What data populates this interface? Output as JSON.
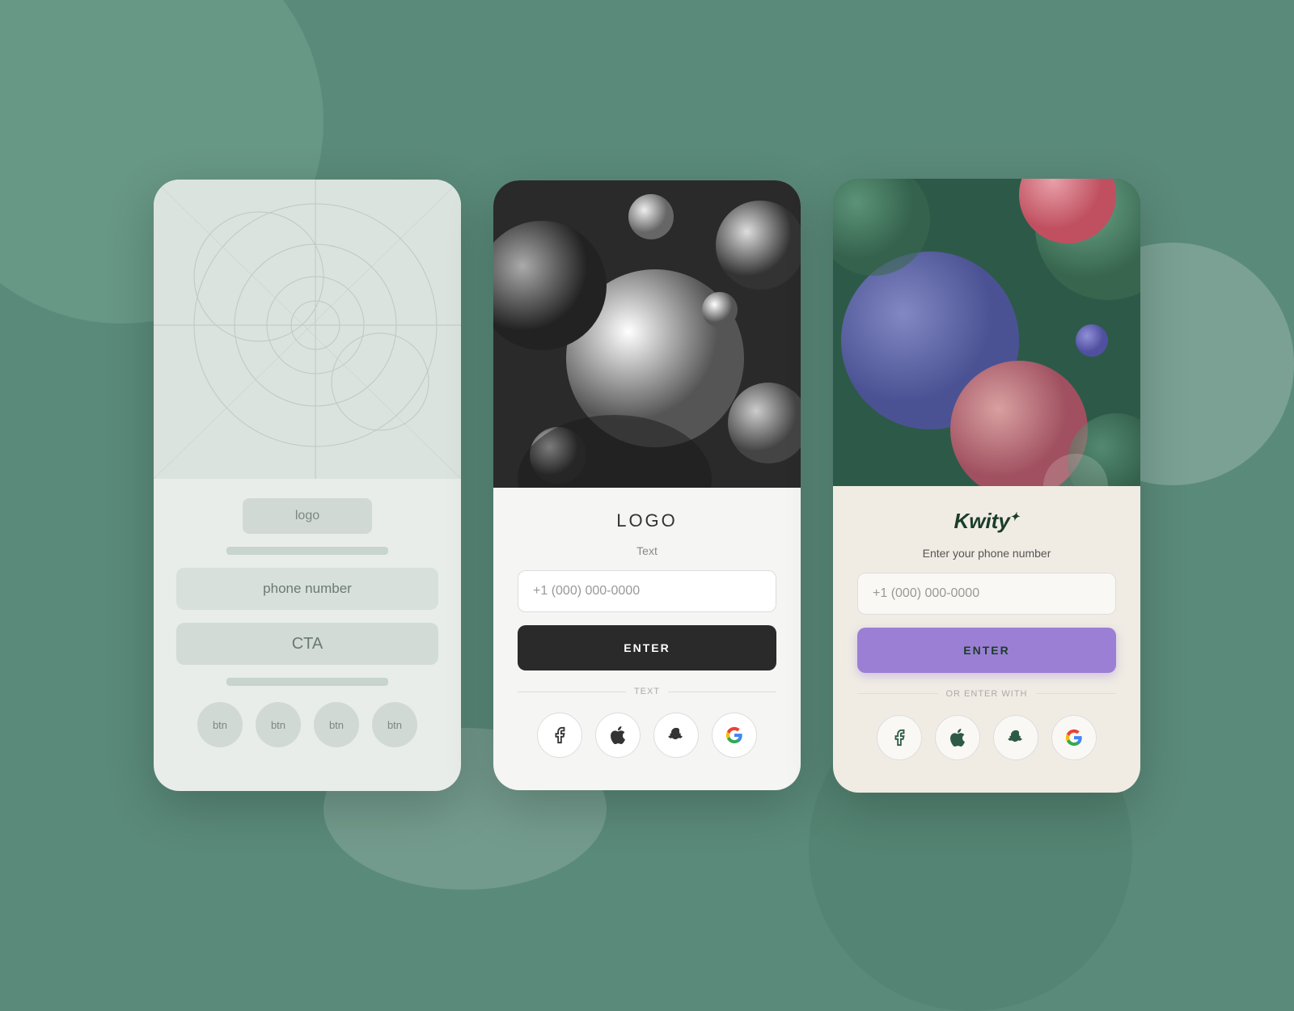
{
  "background": {
    "color": "#5a8a7a"
  },
  "cards": {
    "wireframe": {
      "logo_label": "logo",
      "phone_number_label": "phone number",
      "cta_label": "CTA",
      "btn_labels": [
        "btn",
        "btn",
        "btn",
        "btn"
      ]
    },
    "dark": {
      "logo_label": "LOGO",
      "text_label": "Text",
      "phone_placeholder": "+1 (000) 000-0000",
      "enter_label": "ENTER",
      "divider_text": "TEXT",
      "social_icons": [
        "facebook",
        "apple",
        "snapchat",
        "google"
      ]
    },
    "color": {
      "logo_label": "Kwity",
      "logo_suffix": "✦",
      "subtitle": "Enter your phone number",
      "phone_placeholder": "+1 (000) 000-0000",
      "enter_label": "ENTER",
      "divider_text": "OR ENTER WITH",
      "social_icons": [
        "facebook",
        "apple",
        "snapchat",
        "google"
      ]
    }
  }
}
